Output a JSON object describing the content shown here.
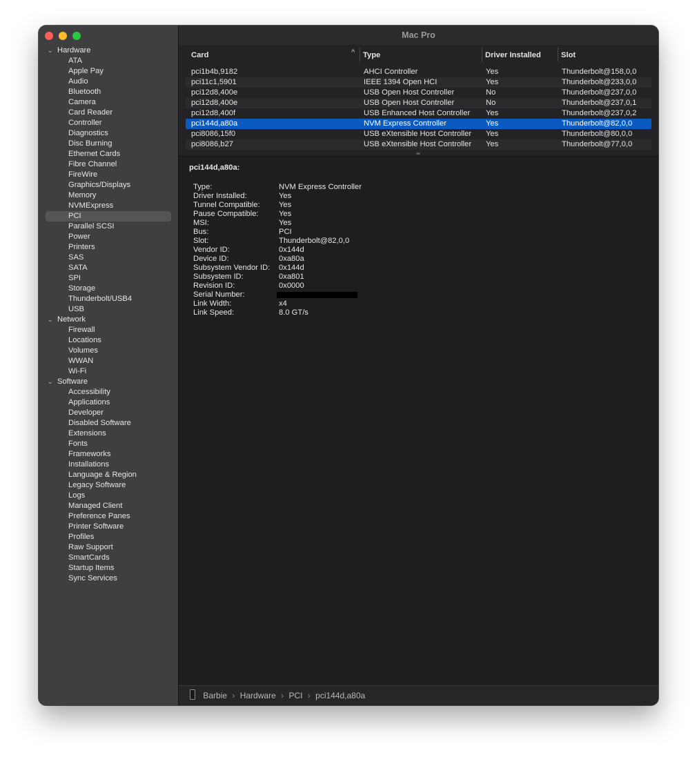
{
  "window": {
    "title": "Mac Pro"
  },
  "sidebar": {
    "groups": [
      {
        "label": "Hardware",
        "items": [
          "ATA",
          "Apple Pay",
          "Audio",
          "Bluetooth",
          "Camera",
          "Card Reader",
          "Controller",
          "Diagnostics",
          "Disc Burning",
          "Ethernet Cards",
          "Fibre Channel",
          "FireWire",
          "Graphics/Displays",
          "Memory",
          "NVMExpress",
          "PCI",
          "Parallel SCSI",
          "Power",
          "Printers",
          "SAS",
          "SATA",
          "SPI",
          "Storage",
          "Thunderbolt/USB4",
          "USB"
        ]
      },
      {
        "label": "Network",
        "items": [
          "Firewall",
          "Locations",
          "Volumes",
          "WWAN",
          "Wi-Fi"
        ]
      },
      {
        "label": "Software",
        "items": [
          "Accessibility",
          "Applications",
          "Developer",
          "Disabled Software",
          "Extensions",
          "Fonts",
          "Frameworks",
          "Installations",
          "Language & Region",
          "Legacy Software",
          "Logs",
          "Managed Client",
          "Preference Panes",
          "Printer Software",
          "Profiles",
          "Raw Support",
          "SmartCards",
          "Startup Items",
          "Sync Services"
        ]
      }
    ],
    "selected": "PCI"
  },
  "table": {
    "columns": [
      "Card",
      "Type",
      "Driver Installed",
      "Slot"
    ],
    "rows": [
      {
        "card": "pci1b4b,9182",
        "type": "AHCI Controller",
        "driver": "Yes",
        "slot": "Thunderbolt@158,0,0"
      },
      {
        "card": "pci11c1,5901",
        "type": "IEEE 1394 Open HCI",
        "driver": "Yes",
        "slot": "Thunderbolt@233,0,0"
      },
      {
        "card": "pci12d8,400e",
        "type": "USB Open Host Controller",
        "driver": "No",
        "slot": "Thunderbolt@237,0,0"
      },
      {
        "card": "pci12d8,400e",
        "type": "USB Open Host Controller",
        "driver": "No",
        "slot": "Thunderbolt@237,0,1"
      },
      {
        "card": "pci12d8,400f",
        "type": "USB Enhanced Host Controller",
        "driver": "Yes",
        "slot": "Thunderbolt@237,0,2"
      },
      {
        "card": "pci144d,a80a",
        "type": "NVM Express Controller",
        "driver": "Yes",
        "slot": "Thunderbolt@82,0,0"
      },
      {
        "card": "pci8086,15f0",
        "type": "USB eXtensible Host Controller",
        "driver": "Yes",
        "slot": "Thunderbolt@80,0,0"
      },
      {
        "card": "pci8086,b27",
        "type": "USB eXtensible Host Controller",
        "driver": "Yes",
        "slot": "Thunderbolt@77,0,0"
      }
    ],
    "selected_index": 5
  },
  "detail": {
    "title": "pci144d,a80a:",
    "properties": [
      {
        "key": "Type:",
        "value": "NVM Express Controller"
      },
      {
        "key": "Driver Installed:",
        "value": "Yes"
      },
      {
        "key": "Tunnel Compatible:",
        "value": "Yes"
      },
      {
        "key": "Pause Compatible:",
        "value": "Yes"
      },
      {
        "key": "MSI:",
        "value": "Yes"
      },
      {
        "key": "Bus:",
        "value": "PCI"
      },
      {
        "key": "Slot:",
        "value": "Thunderbolt@82,0,0"
      },
      {
        "key": "Vendor ID:",
        "value": "0x144d"
      },
      {
        "key": "Device ID:",
        "value": "0xa80a"
      },
      {
        "key": "Subsystem Vendor ID:",
        "value": "0x144d"
      },
      {
        "key": "Subsystem ID:",
        "value": "0xa801"
      },
      {
        "key": "Revision ID:",
        "value": "0x0000"
      },
      {
        "key": "Serial Number:",
        "value": ""
      },
      {
        "key": "Link Width:",
        "value": "x4"
      },
      {
        "key": "Link Speed:",
        "value": "8.0 GT/s"
      }
    ]
  },
  "breadcrumb": [
    "Barbie",
    "Hardware",
    "PCI",
    "pci144d,a80a"
  ],
  "colors": {
    "selection": "#0a5ac2",
    "sidebar_selection": "#555558"
  }
}
